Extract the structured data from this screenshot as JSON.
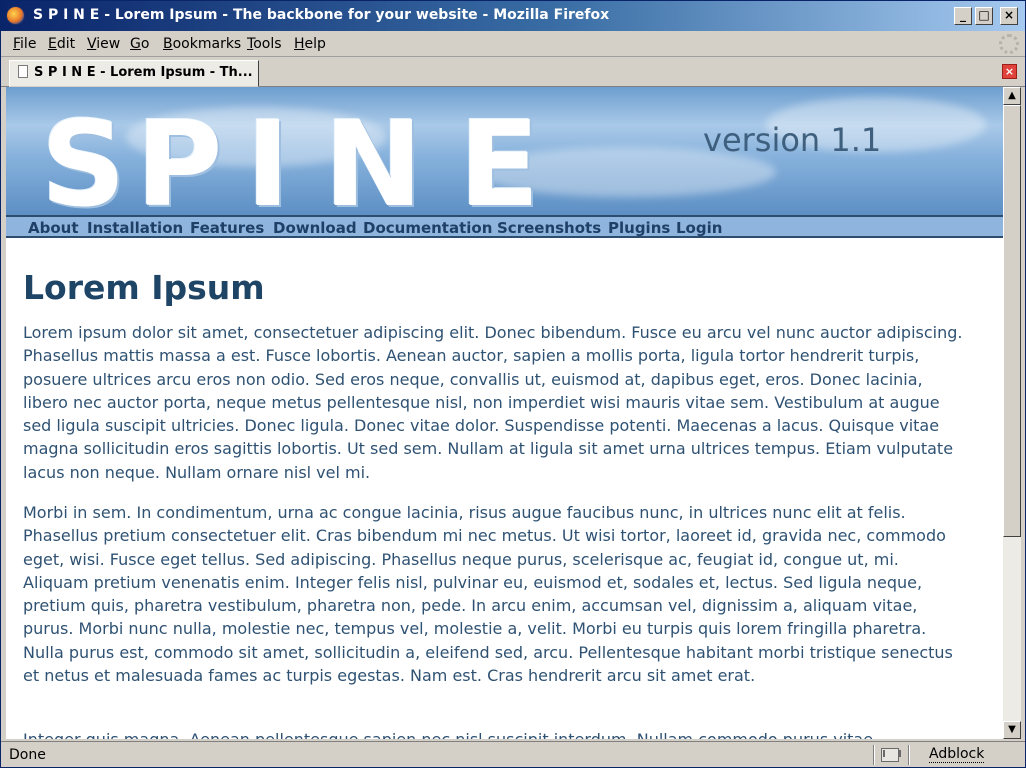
{
  "window": {
    "title": "S P I N E - Lorem Ipsum - The backbone for your website - Mozilla Firefox",
    "controls": {
      "minimize": "_",
      "maximize": "□",
      "close": "×"
    }
  },
  "menu": [
    {
      "label": "File",
      "accel": "F",
      "rest": "ile"
    },
    {
      "label": "Edit",
      "accel": "E",
      "rest": "dit"
    },
    {
      "label": "View",
      "accel": "V",
      "rest": "iew"
    },
    {
      "label": "Go",
      "accel": "G",
      "rest": "o"
    },
    {
      "label": "Bookmarks",
      "accel": "B",
      "rest": "ookmarks"
    },
    {
      "label": "Tools",
      "accel": "T",
      "rest": "ools"
    },
    {
      "label": "Help",
      "accel": "H",
      "rest": "elp"
    }
  ],
  "tab": {
    "label": "S P I N E - Lorem Ipsum - Th..."
  },
  "banner": {
    "logo_letters": [
      "S",
      "P",
      "I",
      "N",
      "E"
    ],
    "version": "version 1.1"
  },
  "nav": [
    "About",
    "Installation",
    "Features",
    "Download",
    "Documentation",
    "Screenshots",
    "Plugins",
    "Login"
  ],
  "content": {
    "title": "Lorem Ipsum",
    "paragraphs": [
      "Lorem ipsum dolor sit amet, consectetuer adipiscing elit. Donec bibendum. Fusce eu arcu vel nunc auctor adipiscing. Phasellus mattis massa a est. Fusce lobortis. Aenean auctor, sapien a mollis porta, ligula tortor hendrerit turpis, posuere ultrices arcu eros non odio. Sed eros neque, convallis ut, euismod at, dapibus eget, eros. Donec lacinia, libero nec auctor porta, neque metus pellentesque nisl, non imperdiet wisi mauris vitae sem. Vestibulum at augue sed ligula suscipit ultricies. Donec ligula. Donec vitae dolor. Suspendisse potenti. Maecenas a lacus. Quisque vitae magna sollicitudin eros sagittis lobortis. Ut sed sem. Nullam at ligula sit amet urna ultrices tempus. Etiam vulputate lacus non neque. Nullam ornare nisl vel mi.",
      "Morbi in sem. In condimentum, urna ac congue lacinia, risus augue faucibus nunc, in ultrices nunc elit at felis. Phasellus pretium consectetuer elit. Cras bibendum mi nec metus. Ut wisi tortor, laoreet id, gravida nec, commodo eget, wisi. Fusce eget tellus. Sed adipiscing. Phasellus neque purus, scelerisque ac, feugiat id, congue ut, mi. Aliquam pretium venenatis enim. Integer felis nisl, pulvinar eu, euismod et, sodales et, lectus. Sed ligula neque, pretium quis, pharetra vestibulum, pharetra non, pede. In arcu enim, accumsan vel, dignissim a, aliquam vitae, purus. Morbi nunc nulla, molestie nec, tempus vel, molestie a, velit. Morbi eu turpis quis lorem fringilla pharetra. Nulla purus est, commodo sit amet, sollicitudin a, eleifend sed, arcu. Pellentesque habitant morbi tristique senectus et netus et malesuada fames ac turpis egestas. Nam est. Cras hendrerit arcu sit amet erat.",
      "Integer quis magna. Aenean pellentesque sapien nec nisl suscipit interdum. Nullam commodo purus vitae"
    ]
  },
  "statusbar": {
    "status": "Done",
    "adblock": "Adblock",
    "mail_icon": "mail-icon"
  },
  "colors": {
    "title_text": "#1e4466",
    "body_text": "#2f5273",
    "nav_text": "#1e3f66",
    "nav_bg": "#8fb4dd"
  }
}
